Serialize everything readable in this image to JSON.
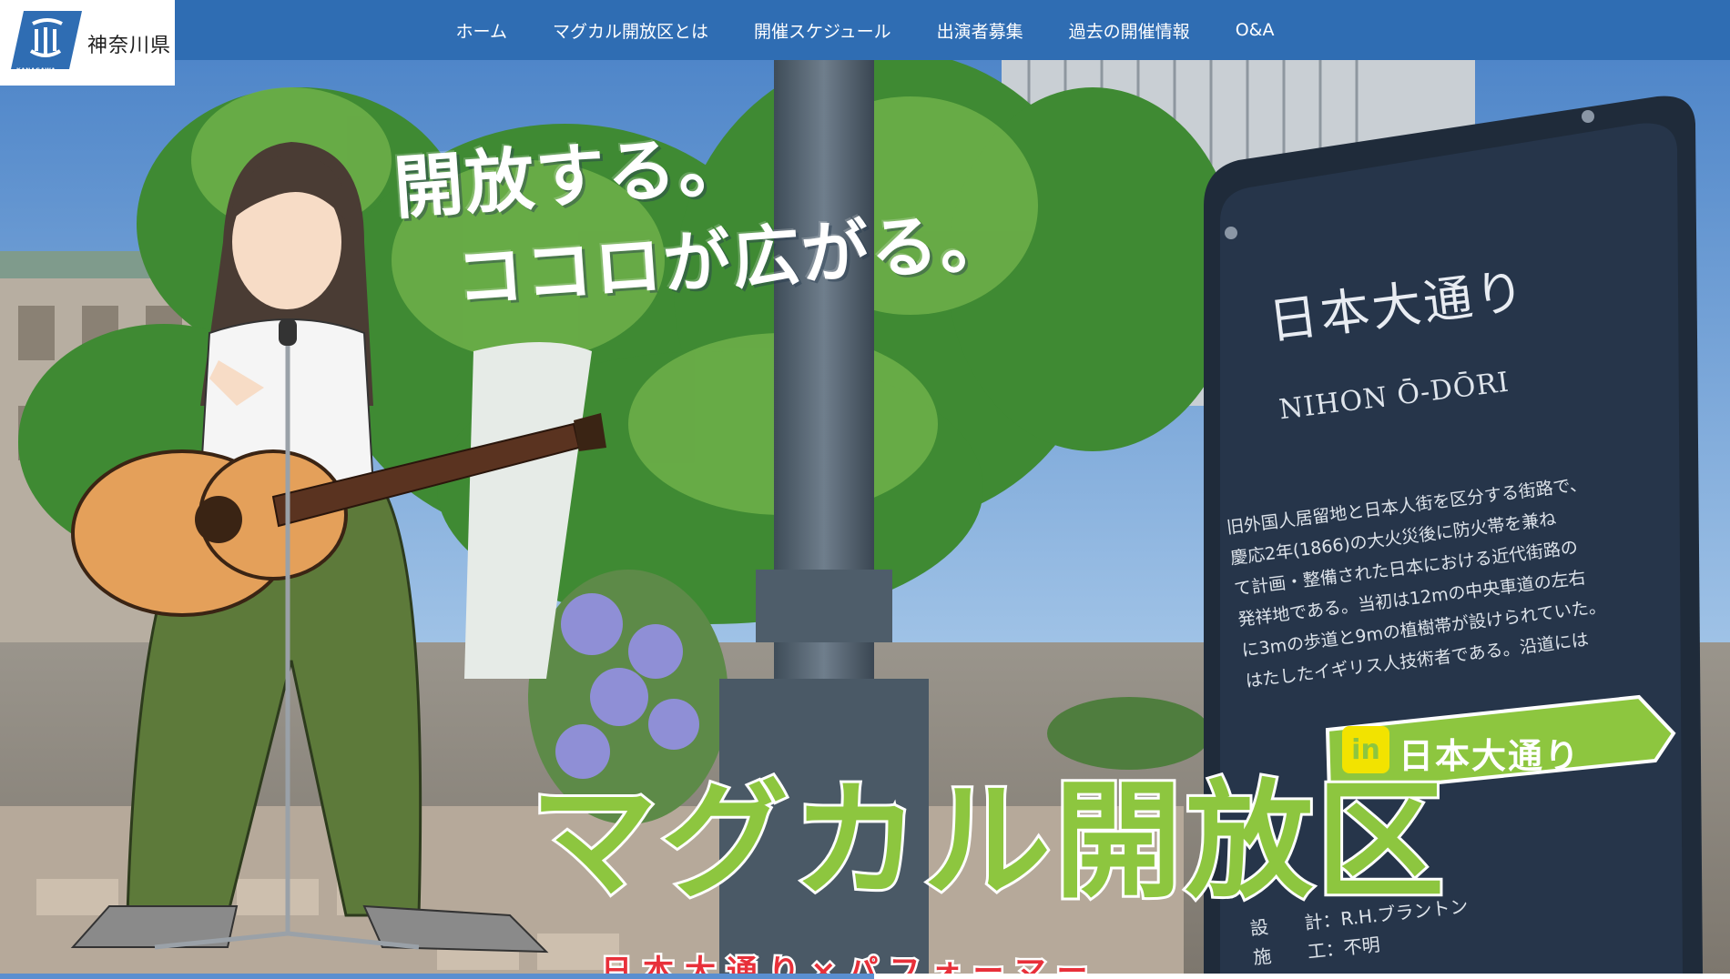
{
  "brand": {
    "name": "神奈川県",
    "sub": "KANAGAWA"
  },
  "nav": {
    "items": [
      {
        "label": "ホーム"
      },
      {
        "label": "マグカル開放区とは"
      },
      {
        "label": "開催スケジュール"
      },
      {
        "label": "出演者募集"
      },
      {
        "label": "過去の開催情報"
      },
      {
        "label": "O&A"
      }
    ]
  },
  "hero": {
    "catch_line1": "開放する。",
    "catch_line2": "ココロが広がる。",
    "title": "マグカル開放区",
    "title_in": "in",
    "title_location": "日本大通り",
    "tagline": "日本大通り×パフォーマー",
    "sign": {
      "title": "日本大通り",
      "subtitle": "NIHON Ō-DŌRI",
      "body": "旧外国人居留地と日本人街を区分する街路で、\n慶応2年(1866)の大火災後に防火帯を兼ね\nて計画・整備された日本における近代街路の\n発祥地である。当初は12mの中央車道の左右\nに3mの歩道と9mの植樹帯が設けられていた。\nはたしたイギリス人技術者である。沿道には",
      "footer": "設　　計：R.H.ブラントン\n施　　工：不明"
    }
  },
  "colors": {
    "header_bg": "#2f6db3",
    "title_green": "#8dc63f",
    "tagline_red": "#e8303a",
    "in_badge_yellow": "#f2e300"
  }
}
